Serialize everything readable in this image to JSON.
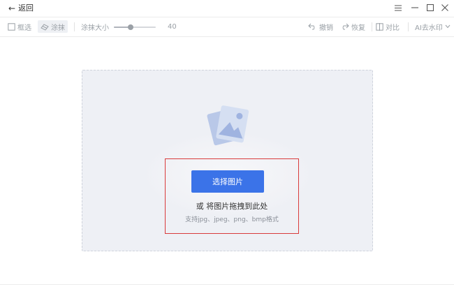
{
  "titlebar": {
    "back_label": "返回",
    "back_icon": "left-arrow-icon",
    "controls": [
      "menu-icon",
      "minimize-icon",
      "maximize-icon",
      "close-icon"
    ]
  },
  "toolbar": {
    "select_box_label": "框选",
    "brush_label": "涂抹",
    "brush_size_label": "涂抹大小",
    "brush_size_value": "40",
    "brush_size_fraction": 0.4,
    "undo_label": "撤销",
    "redo_label": "恢复",
    "compare_label": "对比",
    "ai_label": "AI去水印"
  },
  "upload": {
    "button_label": "选择图片",
    "drag_hint": "或 将图片拖拽到此处",
    "format_hint": "支持jpg、jpeg、png、bmp格式"
  },
  "colors": {
    "accent": "#3b73e8",
    "highlight": "#d93b3b",
    "dropzone_bg": "#eef0f5"
  }
}
